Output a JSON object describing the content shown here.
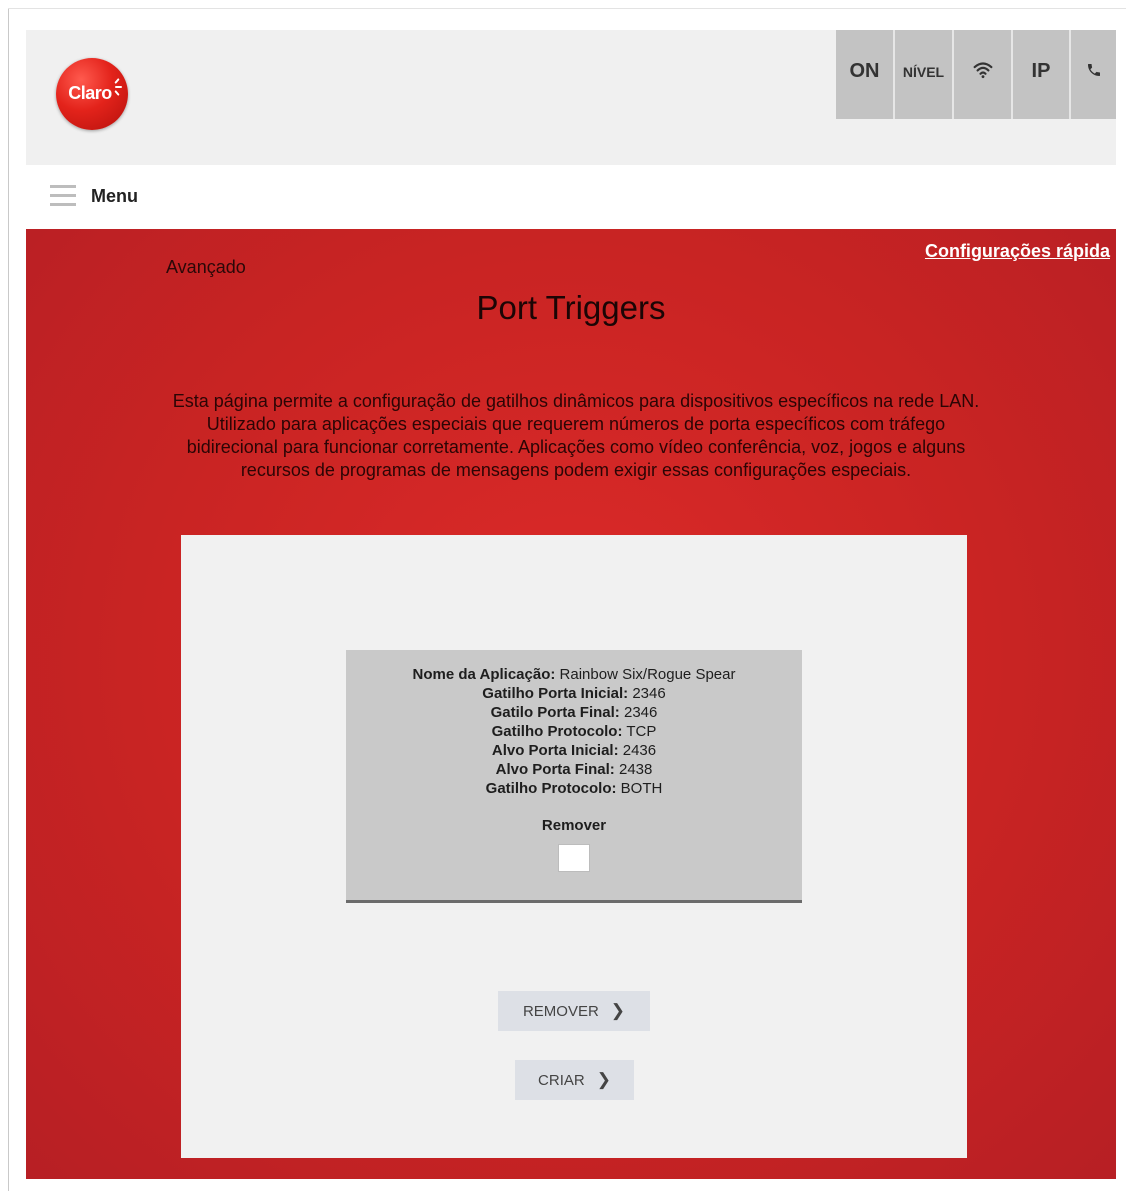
{
  "header": {
    "logo_text": "Claro",
    "status": {
      "on": "ON",
      "nivel": "NÍVEL",
      "wifi_icon": "wifi-icon",
      "ip": "IP",
      "phone_icon": "phone-icon"
    }
  },
  "menu": {
    "label": "Menu",
    "icon": "hamburger-icon"
  },
  "quick_link": "Configurações rápida",
  "breadcrumb": "Avançado",
  "page_title": "Port Triggers",
  "description": "Esta página permite a configuração de gatilhos dinâmicos para dispositivos específicos na rede LAN. Utilizado para aplicações especiais que requerem números de porta específicos com tráfego bidirecional para funcionar corretamente. Aplicações como vídeo conferência, voz, jogos e alguns recursos de programas de mensagens podem exigir essas configurações especiais.",
  "trigger": {
    "rows": [
      {
        "label": "Nome da Aplicação:",
        "value": "Rainbow Six/Rogue Spear"
      },
      {
        "label": "Gatilho Porta Inicial:",
        "value": "2346"
      },
      {
        "label": "Gatilo Porta Final:",
        "value": "2346"
      },
      {
        "label": "Gatilho Protocolo:",
        "value": "TCP"
      },
      {
        "label": "Alvo Porta Inicial:",
        "value": "2436"
      },
      {
        "label": "Alvo Porta Final:",
        "value": "2438"
      },
      {
        "label": "Gatilho Protocolo:",
        "value": "BOTH"
      }
    ],
    "remove_label": "Remover",
    "remove_checked": false
  },
  "buttons": {
    "remove": "REMOVER",
    "create": "CRIAR"
  },
  "colors": {
    "brand_red": "#c92423",
    "panel_bg": "#f1f1f1",
    "card_bg": "#c9c9c9"
  }
}
